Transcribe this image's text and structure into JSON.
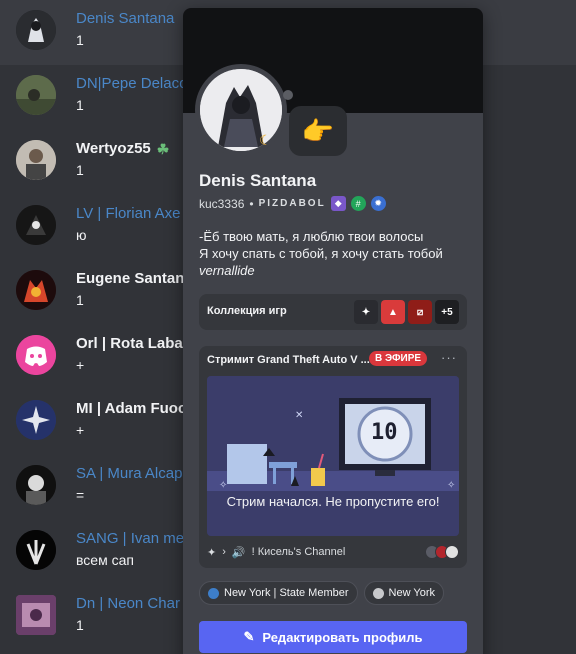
{
  "members": [
    {
      "name": "Denis Santana",
      "status": "1",
      "color": "blue"
    },
    {
      "name": "DN|Pepe Delaco",
      "status": "1",
      "color": "blue"
    },
    {
      "name": "Wertyoz55",
      "status": "1",
      "color": "white"
    },
    {
      "name": "LV | Florian Axe",
      "status": "ю",
      "color": "blue"
    },
    {
      "name": "Eugene Santana",
      "status": "1",
      "color": "white"
    },
    {
      "name": "Orl | Rota Labag",
      "status": "+",
      "color": "white"
    },
    {
      "name": "MI | Adam Fuoc",
      "status": "+",
      "color": "white"
    },
    {
      "name": "SA | Mura Alcap",
      "status": "=",
      "color": "blue"
    },
    {
      "name": "SANG | Ivan me",
      "status": "всем сап",
      "color": "blue"
    },
    {
      "name": "Dn | Neon Char",
      "status": "1",
      "color": "blue"
    }
  ],
  "profile": {
    "display_name": "Denis Santana",
    "username": "kuc3336",
    "separator": "•",
    "clan_tag": "PIZDABOL",
    "status_emoji": "👉",
    "bio_lines": [
      "-Ёб твою мать, я люблю твои волосы",
      "Я хочу спать с тобой, я хочу стать тобой"
    ],
    "bio_italic": "vernallide",
    "games_title": "Коллекция игр",
    "games_more": "+5",
    "stream_title": "Стримит Grand Theft Auto V ...",
    "live_label": "В ЭФИРЕ",
    "more_label": "···",
    "stream_counter": "10",
    "stream_message": "Стрим начался. Не пропустите его!",
    "channel": "! Кисель's Channel",
    "roles": [
      {
        "label": "New York | State Member",
        "color": "#3d7ec9"
      },
      {
        "label": "New York",
        "color": "#c8c9cc"
      }
    ],
    "edit_button": "Редактировать профиль"
  },
  "colors": {
    "accent": "#5865f2",
    "live": "#da373c",
    "member_blue": "#4a87c8"
  }
}
